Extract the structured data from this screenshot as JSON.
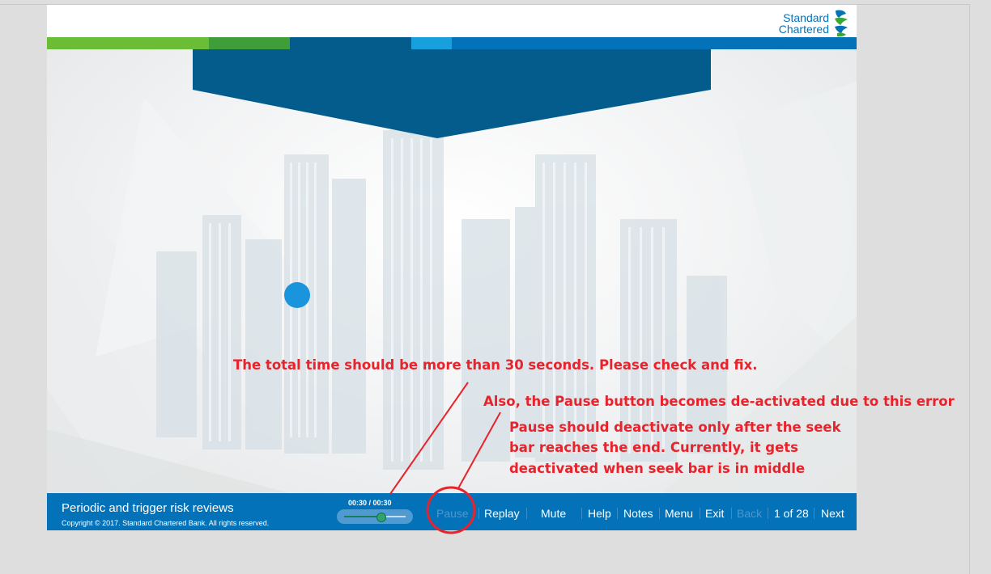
{
  "brand": {
    "logo_line1": "Standard",
    "logo_line2": "Chartered",
    "logo_icon": "standard-chartered-logo-icon",
    "blue": "#0472b8",
    "green": "#38a935",
    "navy": "#035c8c"
  },
  "footer": {
    "course_title": "Periodic and trigger risk reviews",
    "copyright": "Copyright © 2017. Standard Chartered Bank. All rights reserved.",
    "time_display": "00:30 / 00:30",
    "seek_progress": 0.6,
    "controls": {
      "pause": "Pause",
      "replay": "Replay",
      "mute": "Mute",
      "help": "Help",
      "notes": "Notes",
      "menu": "Menu",
      "exit": "Exit",
      "back": "Back",
      "page_counter": "1 of 28",
      "next": "Next"
    }
  },
  "annotations": {
    "note1": "The total time should be more than 30 seconds. Please check and fix.",
    "note2": "Also, the Pause button becomes de-activated due to this error",
    "note3_line1": "Pause should deactivate only after the seek",
    "note3_line2": "bar reaches the end. Currently, it gets",
    "note3_line3": "deactivated when seek bar is in middle",
    "color": "#e8232b"
  }
}
